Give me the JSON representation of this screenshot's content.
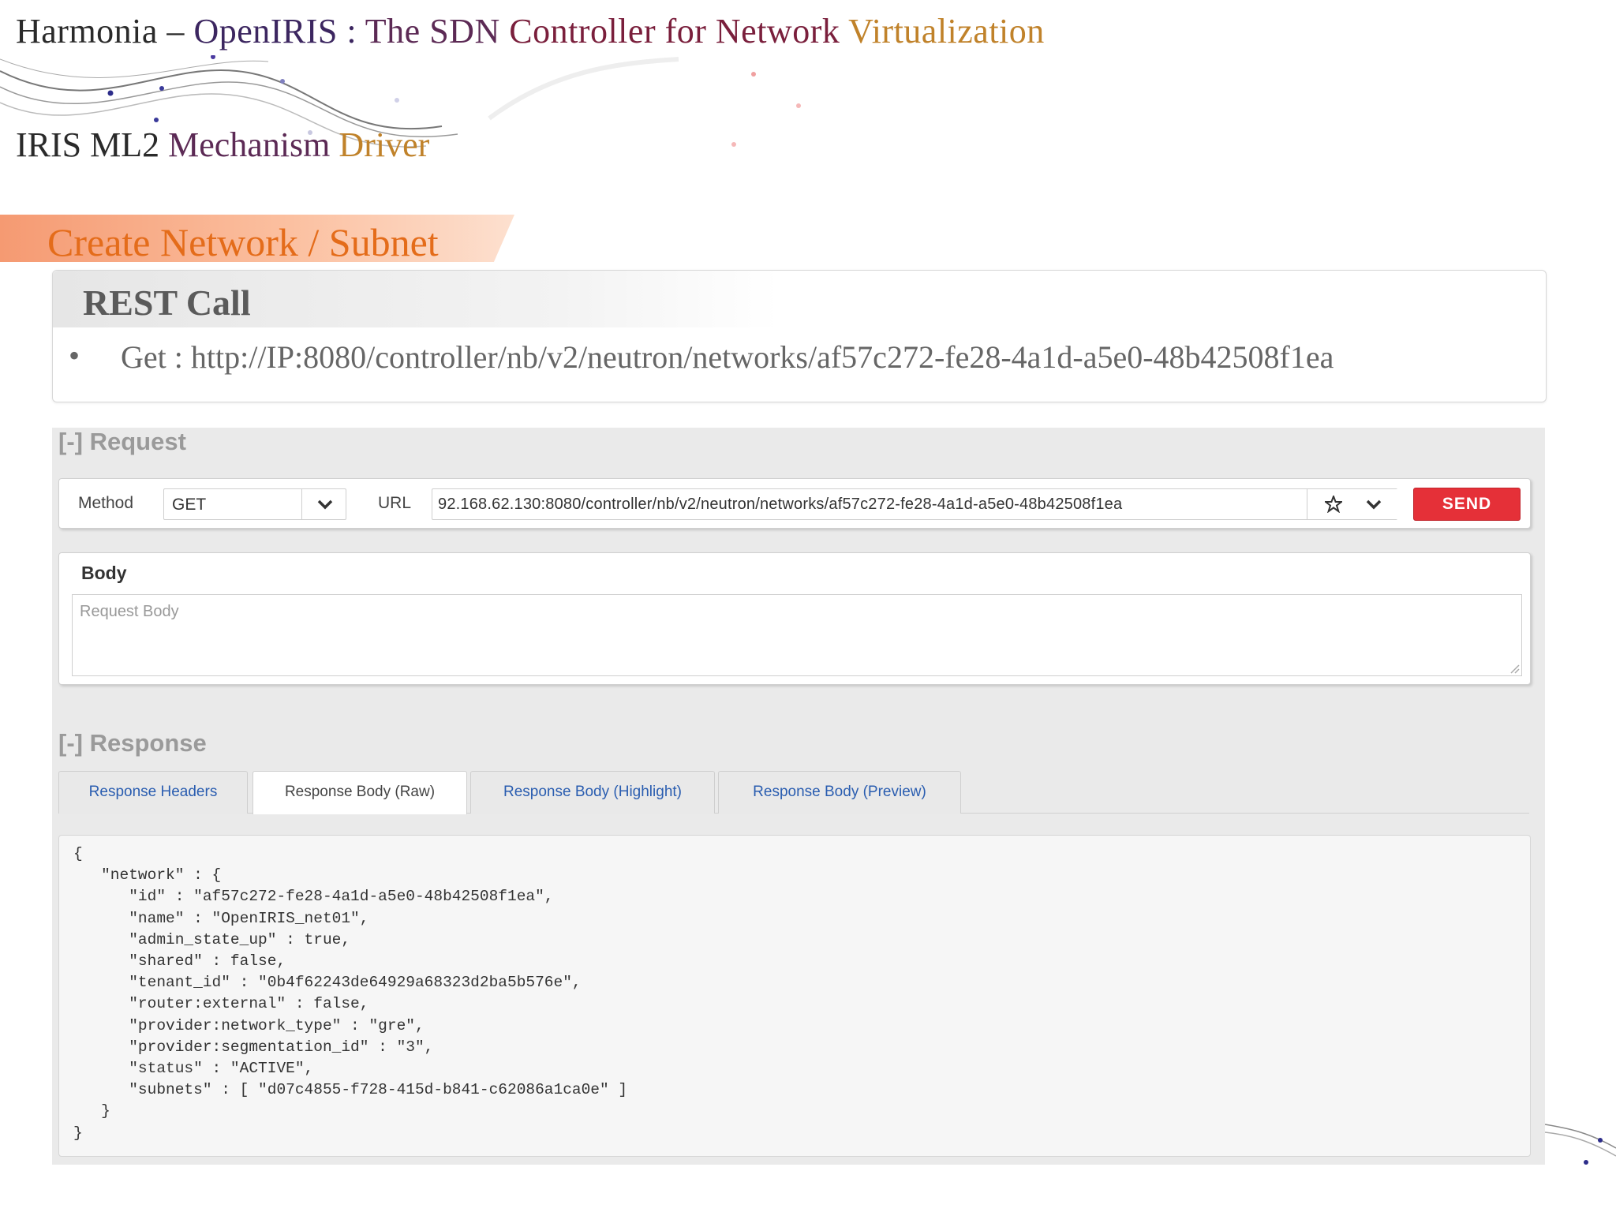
{
  "header": {
    "title_parts": [
      "Harmonia – ",
      "OpenIRIS : ",
      "The SDN ",
      "Controller for Network ",
      "Virtualization"
    ],
    "subtitle_parts": [
      "IRIS ML2 ",
      "Mechanism ",
      "Driver"
    ]
  },
  "section": {
    "title": "Create Network / Subnet"
  },
  "rest_call": {
    "heading": "REST Call",
    "bullet": "•",
    "get": "Get : http://IP:8080/controller/nb/v2/neutron/networks/af57c272-fe28-4a1d-a5e0-48b42508f1ea"
  },
  "request": {
    "section_label": "[-] Request",
    "method_label": "Method",
    "method_value": "GET",
    "url_label": "URL",
    "url_value": "92.168.62.130:8080/controller/nb/v2/neutron/networks/af57c272-fe28-4a1d-a5e0-48b42508f1ea",
    "send_label": "SEND",
    "body_label": "Body",
    "body_placeholder": "Request Body"
  },
  "response": {
    "section_label": "[-] Response",
    "tabs": [
      {
        "label": "Response Headers",
        "active": false
      },
      {
        "label": "Response Body (Raw)",
        "active": true
      },
      {
        "label": "Response Body (Highlight)",
        "active": false
      },
      {
        "label": "Response Body (Preview)",
        "active": false
      }
    ],
    "body_lines": [
      "{",
      "   \"network\" : {",
      "      \"id\" : \"af57c272-fe28-4a1d-a5e0-48b42508f1ea\",",
      "      \"name\" : \"OpenIRIS_net01\",",
      "      \"admin_state_up\" : true,",
      "      \"shared\" : false,",
      "      \"tenant_id\" : \"0b4f62243de64929a68323d2ba5b576e\",",
      "      \"router:external\" : false,",
      "      \"provider:network_type\" : \"gre\",",
      "      \"provider:segmentation_id\" : \"3\",",
      "      \"status\" : \"ACTIVE\",",
      "      \"subnets\" : [ \"d07c4855-f728-415d-b841-c62086a1ca0e\" ]",
      "   }",
      "}"
    ]
  },
  "colors": {
    "accent_orange": "#e46c1a",
    "send_red": "#e53038",
    "tab_link": "#2a5db0"
  }
}
